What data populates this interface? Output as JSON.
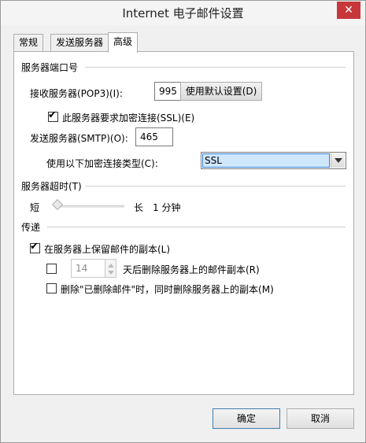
{
  "window": {
    "title": "Internet 电子邮件设置",
    "close_glyph": "✕"
  },
  "tabs": [
    {
      "label": "常规",
      "active": false
    },
    {
      "label": "发送服务器",
      "active": false
    },
    {
      "label": "高级",
      "active": true
    }
  ],
  "ports": {
    "section_title": "服务器端口号",
    "incoming_label": "接收服务器(POP3)(I):",
    "incoming_value": "995",
    "use_defaults_label": "使用默认设置(D)",
    "ssl_checkbox_label": "此服务器要求加密连接(SSL)(E)",
    "ssl_checked": true,
    "outgoing_label": "发送服务器(SMTP)(O):",
    "outgoing_value": "465",
    "encryption_label": "使用以下加密连接类型(C):",
    "encryption_value": "SSL"
  },
  "timeout": {
    "section_title": "服务器超时(T)",
    "short_label": "短",
    "long_label": "长",
    "value_label": "1 分钟",
    "level_fraction": 0.0
  },
  "delivery": {
    "section_title": "传递",
    "keep_copy_label": "在服务器上保留邮件的副本(L)",
    "keep_copy_checked": true,
    "remove_after_checked": false,
    "remove_after_value": "14",
    "remove_after_label": "天后删除服务器上的邮件副本(R)",
    "remove_deleted_checked": false,
    "remove_deleted_label": "删除\"已删除邮件\"时，同时删除服务器上的副本(M)"
  },
  "footer": {
    "ok_label": "确定",
    "cancel_label": "取消"
  },
  "colors": {
    "accent": "#3a7fd4",
    "selection": "#cfe7fb",
    "close": "#c7373a"
  }
}
